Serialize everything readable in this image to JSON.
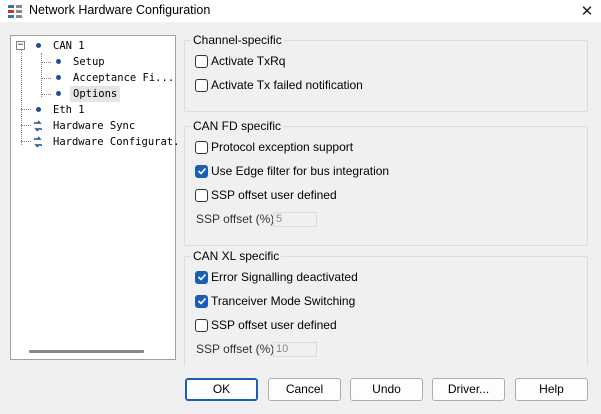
{
  "window": {
    "title": "Network Hardware Configuration"
  },
  "tree": {
    "items": [
      {
        "label": "CAN 1",
        "level": 0,
        "type": "node"
      },
      {
        "label": "Setup",
        "level": 1,
        "type": "leaf"
      },
      {
        "label": "Acceptance Fi...",
        "level": 1,
        "type": "leaf"
      },
      {
        "label": "Options",
        "level": 1,
        "type": "leaf",
        "selected": true
      },
      {
        "label": "Eth 1",
        "level": 0,
        "type": "node"
      },
      {
        "label": "Hardware Sync",
        "level": 0,
        "type": "sync"
      },
      {
        "label": "Hardware Configurat.",
        "level": 0,
        "type": "sync"
      }
    ]
  },
  "channel_specific": {
    "title": "Channel-specific",
    "activate_txrq": {
      "label": "Activate TxRq",
      "checked": false
    },
    "activate_tx_failed": {
      "label": "Activate Tx failed notification",
      "checked": false
    }
  },
  "can_fd": {
    "title": "CAN FD specific",
    "protocol_exception": {
      "label": "Protocol exception support",
      "checked": false
    },
    "edge_filter": {
      "label": "Use Edge filter for bus integration",
      "checked": true
    },
    "ssp_user_defined": {
      "label": "SSP offset user defined",
      "checked": false
    },
    "ssp_offset_label": "SSP offset (%):",
    "ssp_offset_value": "5"
  },
  "can_xl": {
    "title": "CAN XL specific",
    "error_signalling": {
      "label": "Error Signalling deactivated",
      "checked": true
    },
    "tranceiver_switching": {
      "label": "Tranceiver Mode Switching",
      "checked": true
    },
    "ssp_user_defined": {
      "label": "SSP offset user defined",
      "checked": false
    },
    "ssp_offset_label": "SSP offset (%):",
    "ssp_offset_value": "10"
  },
  "buttons": {
    "ok": "OK",
    "cancel": "Cancel",
    "undo": "Undo",
    "driver": "Driver...",
    "help": "Help"
  },
  "colors": {
    "accent": "#1a5fb4",
    "bullet": "#1f4e8c"
  }
}
